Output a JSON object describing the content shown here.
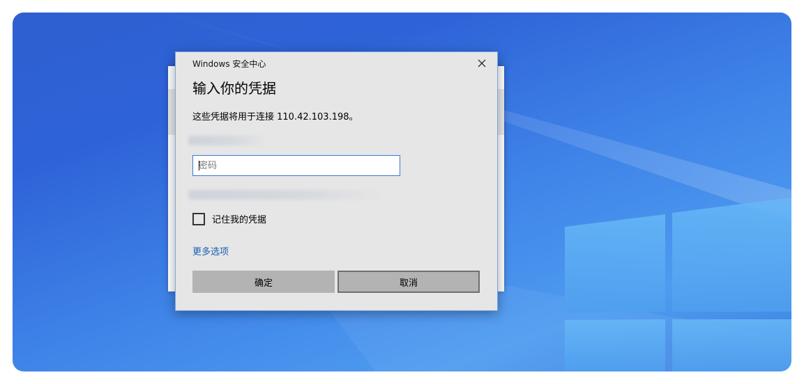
{
  "desktop": {
    "colors": {
      "wallpaper_dark": "#2f5fd0",
      "wallpaper_light": "#4e9bf0",
      "window_pane": "#5fb0f5"
    }
  },
  "dialog": {
    "caption": "Windows 安全中心",
    "title": "输入你的凭据",
    "description": "这些凭据将用于连接 110.42.103.198。",
    "password": {
      "placeholder": "密码",
      "value": ""
    },
    "remember_label": "记住我的凭据",
    "remember_checked": false,
    "more_options_label": "更多选项",
    "ok_label": "确定",
    "cancel_label": "取消",
    "close_icon": "close-icon",
    "colors": {
      "background": "#e6e6e6",
      "accent": "#3a78d8",
      "link": "#1a5fb4",
      "button": "#b3b3b3"
    }
  }
}
